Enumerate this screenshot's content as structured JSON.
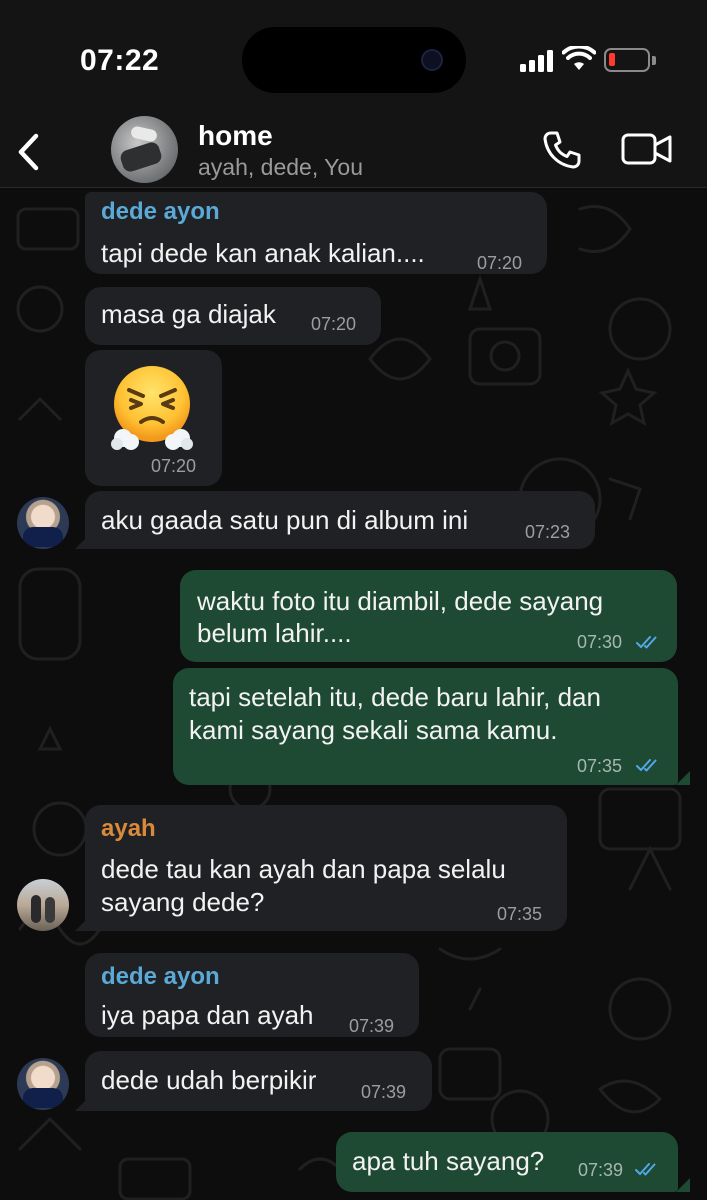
{
  "status_bar": {
    "time": "07:22",
    "icons": [
      "signal-bars-icon",
      "wifi-icon",
      "battery-low-icon"
    ],
    "battery_color": "#ff3b30"
  },
  "header": {
    "title": "home",
    "subtitle": "ayah, dede, You",
    "icons": [
      "back-chevron-icon",
      "phone-call-icon",
      "video-call-icon"
    ]
  },
  "colors": {
    "incoming_bubble": "#202124",
    "outgoing_bubble": "#1e4a33",
    "dede_name": "#5aa9d6",
    "ayah_name": "#d98a3a",
    "read_ticks": "#53a6e8"
  },
  "messages": [
    {
      "direction": "in",
      "sender": "dede ayon",
      "lines": [
        "tapi dede kan anak kalian...."
      ],
      "time": "07:20"
    },
    {
      "direction": "in",
      "lines": [
        "masa ga diajak"
      ],
      "time": "07:20"
    },
    {
      "direction": "in",
      "sticker": "face-with-steam-from-nose-emoji",
      "time": "07:20"
    },
    {
      "direction": "in",
      "lines": [
        "aku gaada satu pun di album ini"
      ],
      "time": "07:23"
    },
    {
      "direction": "out",
      "lines": [
        "waktu foto itu diambil, dede sayang",
        "belum lahir...."
      ],
      "time": "07:30",
      "read": true
    },
    {
      "direction": "out",
      "lines": [
        "tapi setelah itu, dede baru lahir, dan",
        "kami sayang sekali sama kamu."
      ],
      "time": "07:35",
      "read": true
    },
    {
      "direction": "in",
      "sender": "ayah",
      "lines": [
        "dede tau kan ayah dan papa selalu",
        "sayang dede?"
      ],
      "time": "07:35"
    },
    {
      "direction": "in",
      "sender": "dede ayon",
      "lines": [
        "iya papa dan ayah"
      ],
      "time": "07:39"
    },
    {
      "direction": "in",
      "lines": [
        "dede udah berpikir"
      ],
      "time": "07:39"
    },
    {
      "direction": "out",
      "lines": [
        "apa tuh sayang?"
      ],
      "time": "07:39",
      "read": true
    }
  ]
}
